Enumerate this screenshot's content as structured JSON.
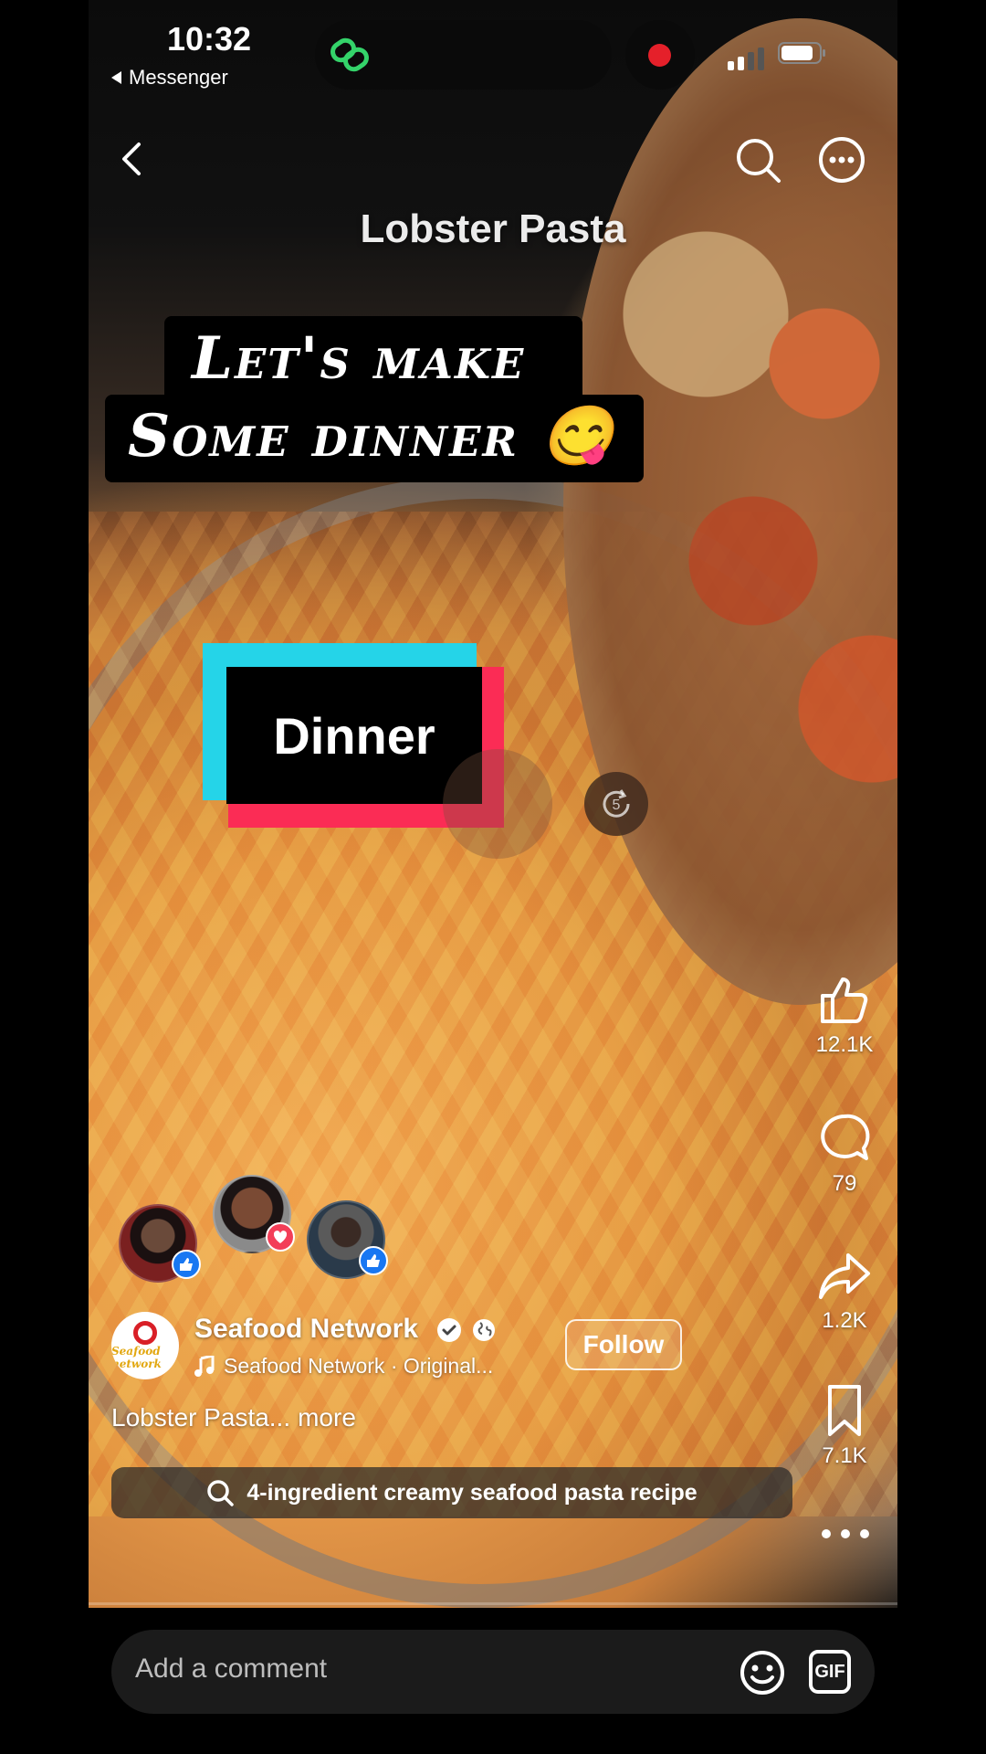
{
  "status_bar": {
    "time": "10:32",
    "back_app": "Messenger"
  },
  "header": {
    "video_title": "Lobster Pasta"
  },
  "overlay": {
    "caption_line1": "Let's make",
    "caption_line2": "Some dinner 😋",
    "sticker": "Dinner"
  },
  "actions": {
    "likes": "12.1K",
    "comments": "79",
    "shares": "1.2K",
    "saves": "7.1K"
  },
  "author": {
    "name": "Seafood Network",
    "audio": "Seafood Network · Original...",
    "follow_label": "Follow",
    "logo_text": "Seafood network"
  },
  "post": {
    "caption": "Lobster Pasta...",
    "more_label": "more"
  },
  "search_suggestion": "4-ingredient creamy seafood pasta recipe",
  "comment_bar": {
    "placeholder": "Add a comment",
    "gif_label": "GIF"
  },
  "colors": {
    "like_blue": "#1877f2",
    "love_red": "#f33e58",
    "sticker_cyan": "#25d4e8",
    "sticker_red": "#fb2c55",
    "record_red": "#e5202a"
  }
}
